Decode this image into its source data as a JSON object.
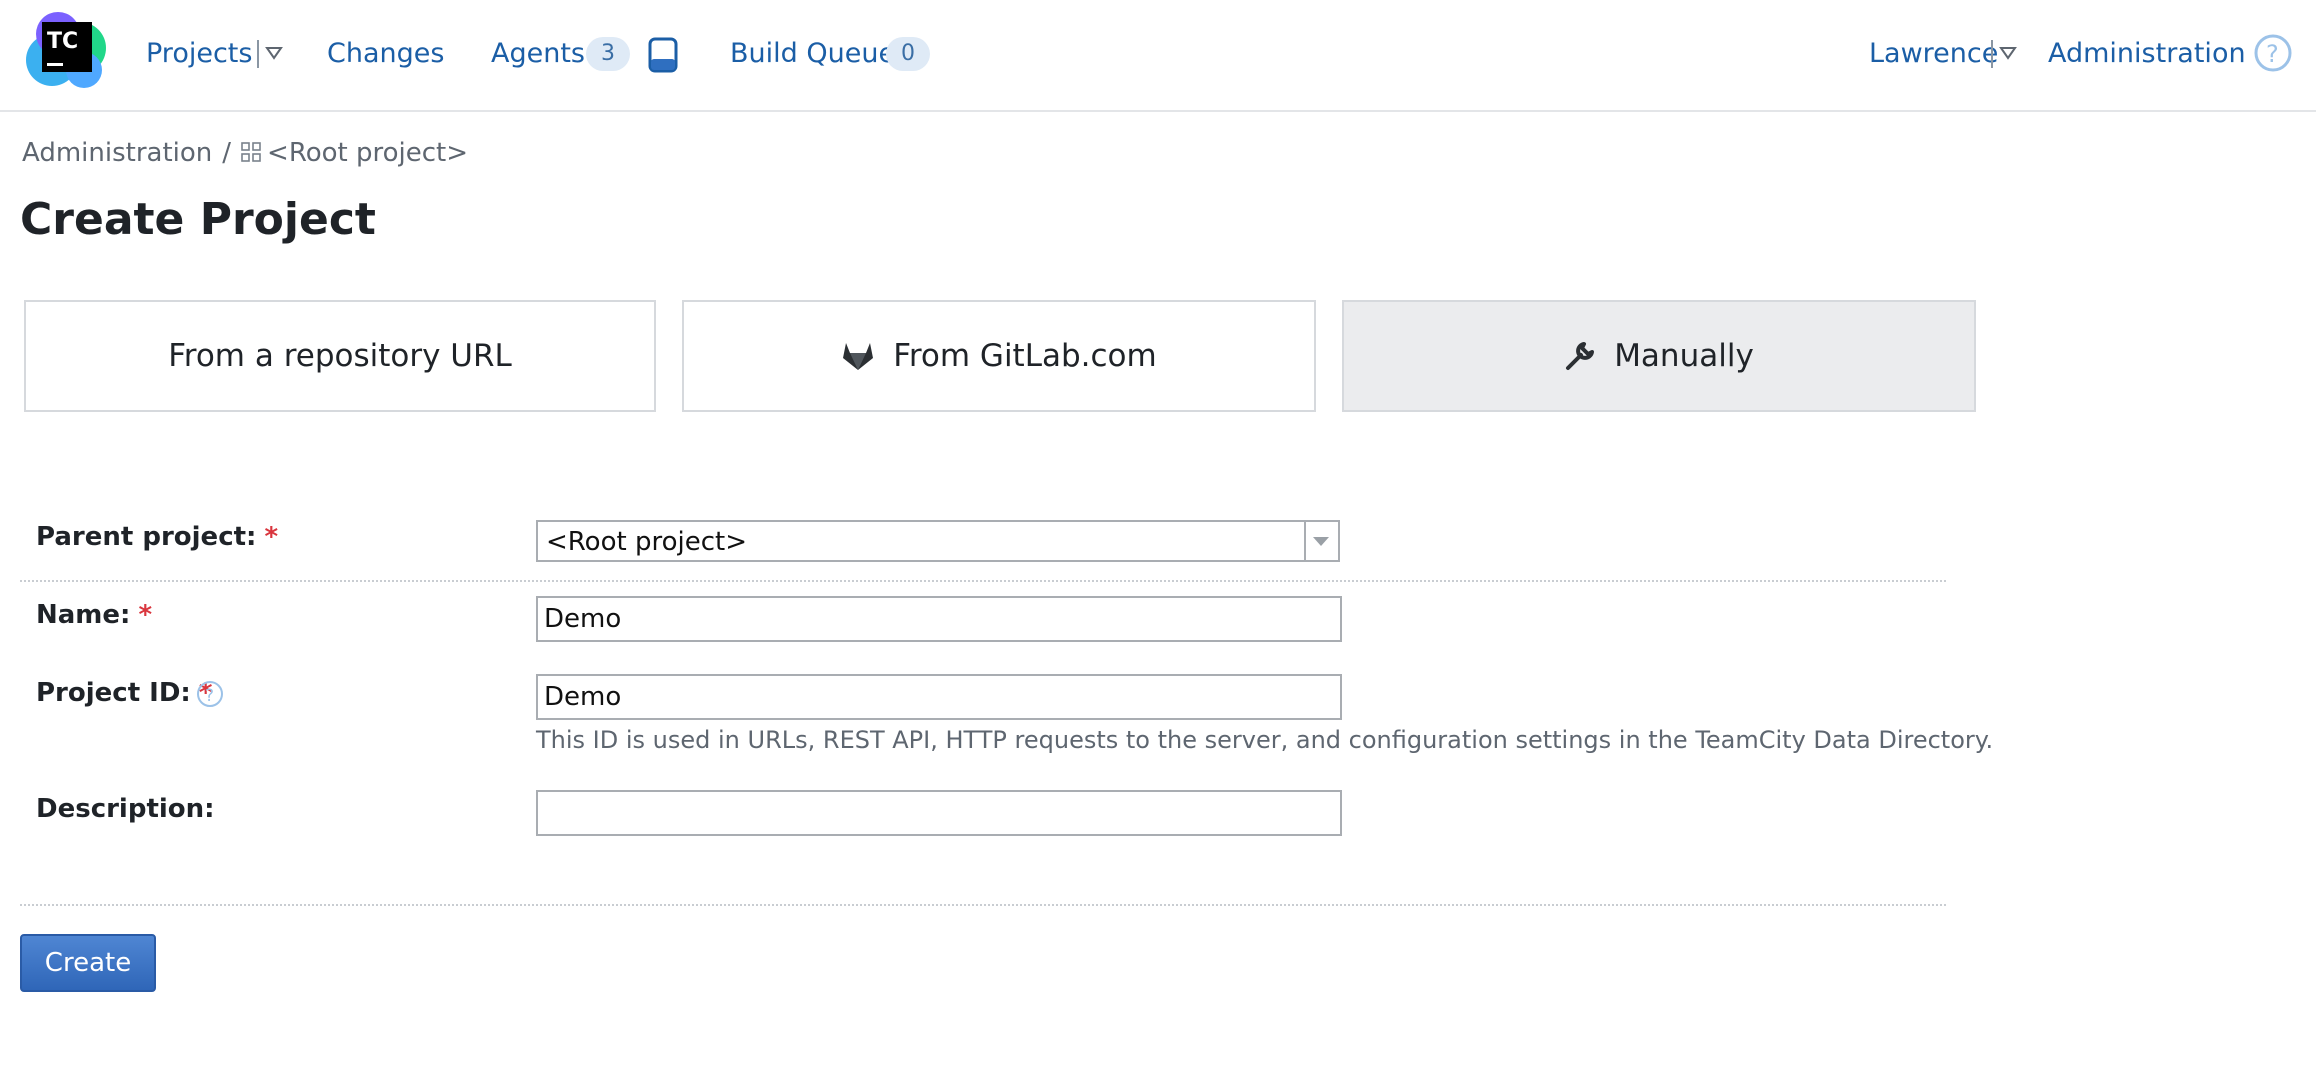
{
  "header": {
    "logo_text": "TC",
    "nav": {
      "projects": "Projects",
      "changes": "Changes",
      "agents": "Agents",
      "agents_count": "3",
      "build_queue": "Build Queue",
      "build_queue_count": "0"
    },
    "user": "Lawrence",
    "administration": "Administration",
    "icons": [
      "teamcity-logo",
      "chevron-down-icon",
      "agent-device-icon",
      "help-icon"
    ]
  },
  "breadcrumb": {
    "items": [
      "Administration",
      "<Root project>"
    ],
    "separator": "/"
  },
  "page_title": "Create Project",
  "source_tabs": {
    "repo_url": "From a repository URL",
    "gitlab": "From GitLab.com",
    "manually": "Manually",
    "active": "manually"
  },
  "form": {
    "parent_project": {
      "label": "Parent project:",
      "required": "*",
      "value": "<Root project>"
    },
    "name": {
      "label": "Name:",
      "required": "*",
      "value": "Demo"
    },
    "project_id": {
      "label": "Project ID:",
      "required": "*",
      "value": "Demo",
      "hint": "This ID is used in URLs, REST API, HTTP requests to the server, and configuration settings in the TeamCity Data Directory."
    },
    "description": {
      "label": "Description:",
      "value": ""
    }
  },
  "create_button": "Create",
  "colors": {
    "link": "#1b5ea6",
    "required": "#d9363e",
    "primary_button": "#2f66b8",
    "active_tab": "#ebecee"
  }
}
